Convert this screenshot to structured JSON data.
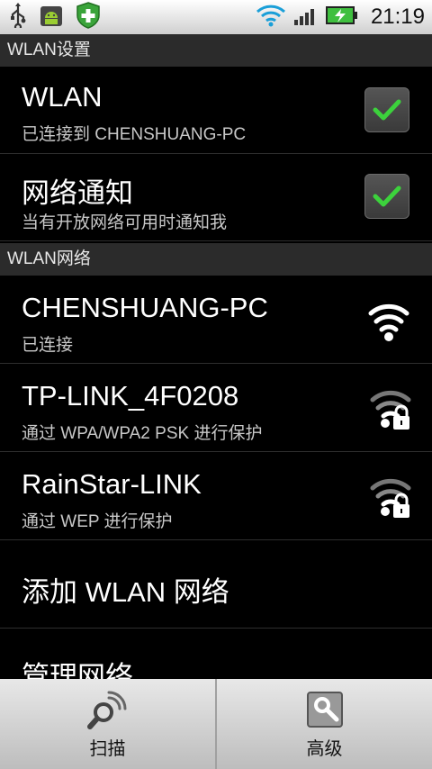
{
  "status_bar": {
    "time": "21:19",
    "icons": [
      "usb-icon",
      "android-debug-icon",
      "shield-plus-icon",
      "wifi-signal-icon",
      "cell-signal-icon",
      "battery-charging-icon"
    ]
  },
  "header": {
    "title": "WLAN设置"
  },
  "settings": [
    {
      "title": "WLAN",
      "subtitle": "已连接到 CHENSHUANG-PC",
      "checked": true
    },
    {
      "title": "网络通知",
      "subtitle": "当有开放网络可用时通知我",
      "checked": true
    }
  ],
  "networks_header": {
    "title": "WLAN网络"
  },
  "networks": [
    {
      "ssid": "CHENSHUANG-PC",
      "status": "已连接",
      "secured": false,
      "signal_icon": "wifi-full-icon"
    },
    {
      "ssid": "TP-LINK_4F0208",
      "status": "通过 WPA/WPA2 PSK 进行保护",
      "secured": true,
      "signal_icon": "wifi-locked-icon"
    },
    {
      "ssid": "RainStar-LINK",
      "status": "通过 WEP 进行保护",
      "secured": true,
      "signal_icon": "wifi-locked-icon"
    }
  ],
  "actions": {
    "add_network": "添加 WLAN 网络",
    "manage_networks": "管理网络"
  },
  "bottom_bar": {
    "scan_label": "扫描",
    "advanced_label": "高级",
    "scan_icon": "scan-search-icon",
    "advanced_icon": "settings-wrench-icon"
  },
  "colors": {
    "check_green": "#3cd23c",
    "section_header_bg": "#2b2b2b",
    "background": "#000000"
  }
}
